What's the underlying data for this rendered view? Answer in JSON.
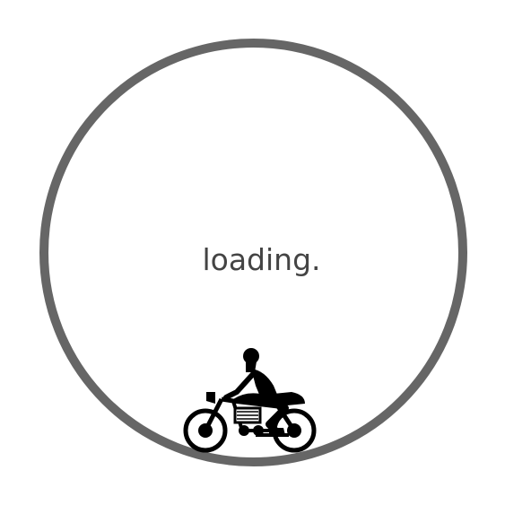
{
  "loader": {
    "text": "loading.",
    "ring_color": "#666666",
    "text_color": "#444444",
    "icon": "motorcycle-rider-icon"
  }
}
